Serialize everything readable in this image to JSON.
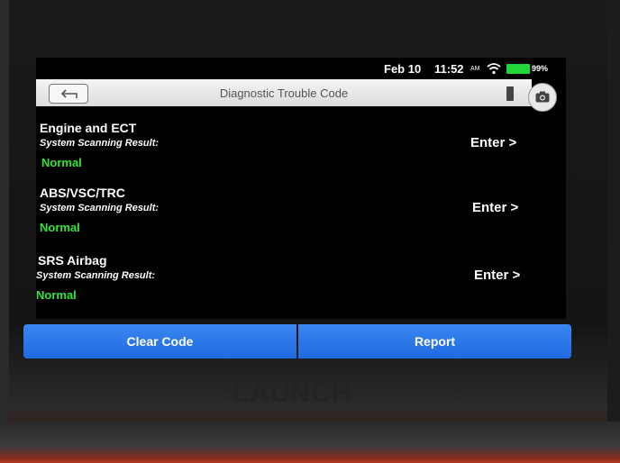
{
  "status_bar": {
    "date": "Feb 10",
    "time": "11:52",
    "ampm": "AM",
    "battery": "99%"
  },
  "title_bar": {
    "title": "Diagnostic Trouble Code"
  },
  "results": [
    {
      "system": "Engine and ECT",
      "subtitle": "System Scanning Result:",
      "status": "Normal",
      "action": "Enter >"
    },
    {
      "system": "ABS/VSC/TRC",
      "subtitle": "System Scanning Result:",
      "status": "Normal",
      "action": "Enter >"
    },
    {
      "system": "SRS Airbag",
      "subtitle": "System Scanning Result:",
      "status": "Normal",
      "action": "Enter >"
    }
  ],
  "buttons": {
    "clear": "Clear Code",
    "report": "Report"
  },
  "device": {
    "brand": "LAUNCH"
  },
  "colors": {
    "accent": "#2a7ae8",
    "normal": "#35e43a",
    "battery": "#22d63a"
  },
  "icons": [
    "back-arrow-icon",
    "wifi-icon",
    "battery-icon",
    "print-icon",
    "camera-icon"
  ]
}
